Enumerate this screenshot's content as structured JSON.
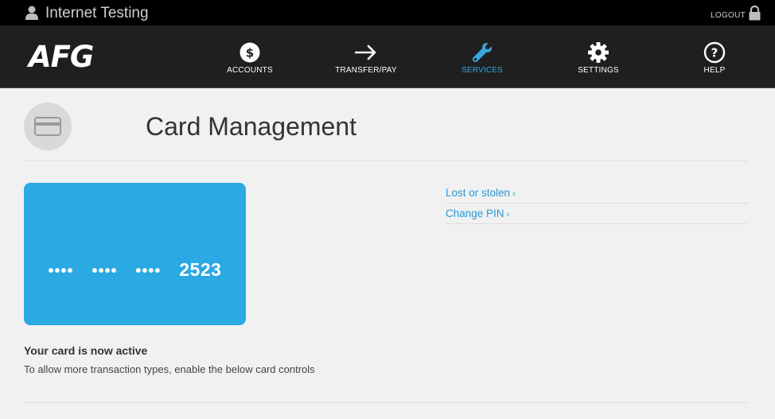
{
  "topbar": {
    "title": "Internet Testing",
    "logout_label": "LOGOUT"
  },
  "nav": {
    "logo": "AFG",
    "items": [
      {
        "label": "ACCOUNTS",
        "icon": "dollar-circle-icon"
      },
      {
        "label": "TRANSFER/PAY",
        "icon": "arrow-right-icon"
      },
      {
        "label": "SERVICES",
        "icon": "wrench-icon",
        "active": true
      },
      {
        "label": "SETTINGS",
        "icon": "gear-icon"
      },
      {
        "label": "HELP",
        "icon": "question-circle-icon"
      }
    ],
    "active_color": "#3aa6dc"
  },
  "page": {
    "title": "Card Management",
    "icon": "credit-card-icon"
  },
  "card": {
    "mask": "••••",
    "last_four": "2523",
    "color": "#2aa9e2"
  },
  "status": {
    "title": "Your card is now active",
    "description": "To allow more transaction types, enable the below card controls"
  },
  "links": [
    {
      "label": "Lost or stolen",
      "chevron": "›"
    },
    {
      "label": "Change PIN",
      "chevron": "›"
    }
  ]
}
